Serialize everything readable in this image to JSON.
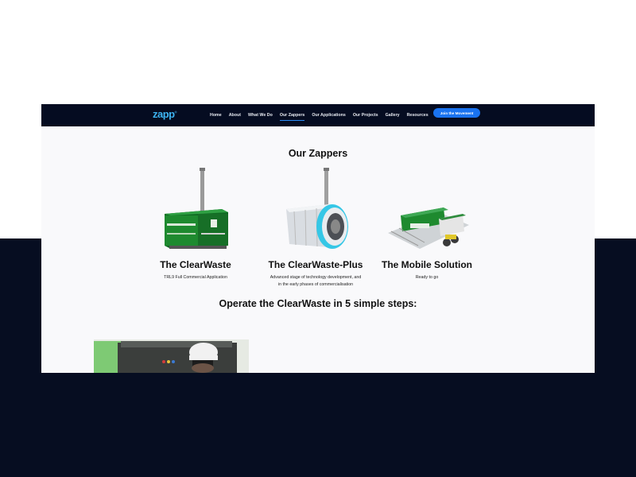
{
  "site": {
    "logo_text": "zapp"
  },
  "nav": {
    "items": [
      {
        "label": "Home"
      },
      {
        "label": "About"
      },
      {
        "label": "What We Do"
      },
      {
        "label": "Our Zappers",
        "active": true
      },
      {
        "label": "Our Applications"
      },
      {
        "label": "Our Projects"
      },
      {
        "label": "Gallery"
      },
      {
        "label": "Resources"
      }
    ],
    "cta_label": "Join the Movement"
  },
  "zappers": {
    "title": "Our Zappers",
    "cards": [
      {
        "title": "The ClearWaste",
        "description": "TRL9 Full Commercial Application"
      },
      {
        "title": "The ClearWaste-Plus",
        "description_line1": "Advanced stage of technology development, and",
        "description_line2": "in the early phases of commercialisation"
      },
      {
        "title": "The Mobile Solution",
        "description": "Ready to go"
      }
    ]
  },
  "steps": {
    "title": "Operate the ClearWaste in 5 simple steps:"
  },
  "colors": {
    "nav_bg": "#050c21",
    "page_bg_dark": "#060d21",
    "accent": "#1a73f0",
    "logo": "#3db4f2",
    "machine_green": "#1e8a2f"
  }
}
